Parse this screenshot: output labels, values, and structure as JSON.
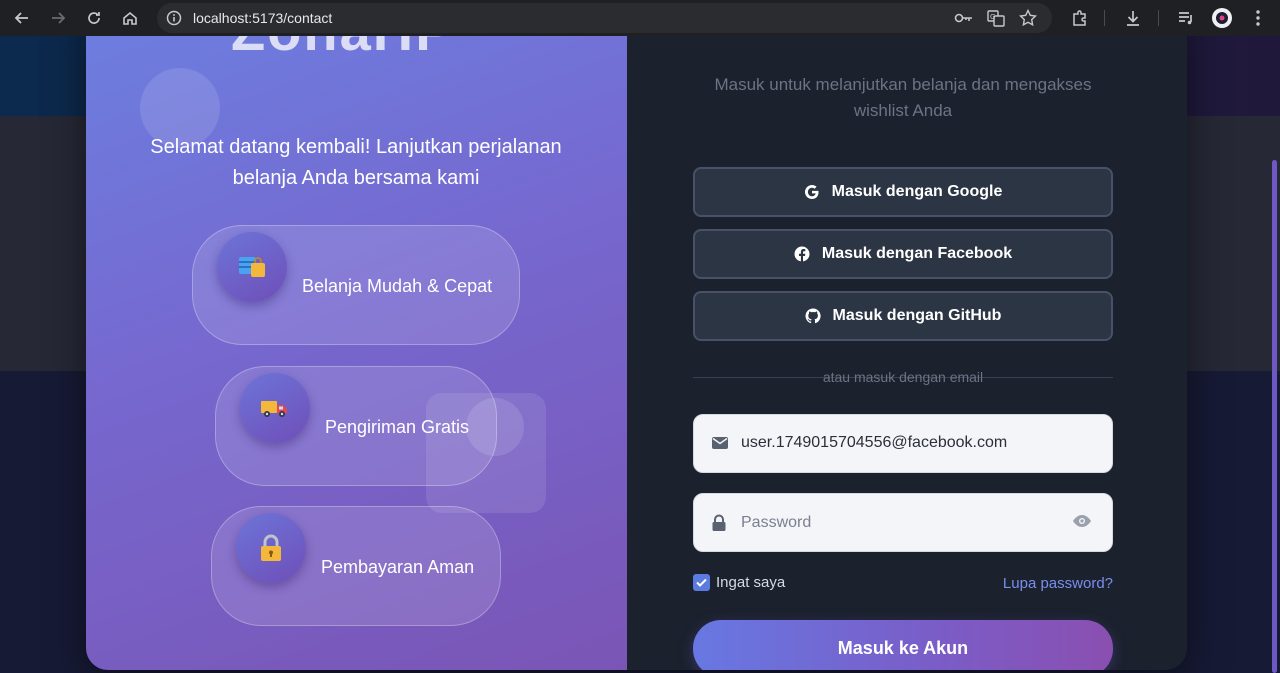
{
  "browser": {
    "url": "localhost:5173/contact"
  },
  "brand": {
    "name": "ZonaHP"
  },
  "left_panel": {
    "welcome": "Selamat datang kembali! Lanjutkan perjalanan belanja Anda bersama kami",
    "features": [
      {
        "label": "Belanja Mudah & Cepat",
        "icon": "shopping-bag-icon"
      },
      {
        "label": "Pengiriman Gratis",
        "icon": "delivery-truck-icon"
      },
      {
        "label": "Pembayaran Aman",
        "icon": "lock-icon"
      }
    ]
  },
  "right_panel": {
    "subtitle": "Masuk untuk melanjutkan belanja dan mengakses wishlist Anda",
    "google_label": "Masuk dengan Google",
    "facebook_label": "Masuk dengan Facebook",
    "github_label": "Masuk dengan GitHub",
    "divider_text": "atau masuk dengan email",
    "email_value": "user.1749015704556@facebook.com",
    "password_placeholder": "Password",
    "remember_label": "Ingat saya",
    "remember_checked": true,
    "forgot_label": "Lupa password?",
    "submit_label": "Masuk ke Akun"
  },
  "colors": {
    "accent": "#6878e2",
    "link": "#7a8ef0",
    "panel_dark": "#1b212d"
  }
}
